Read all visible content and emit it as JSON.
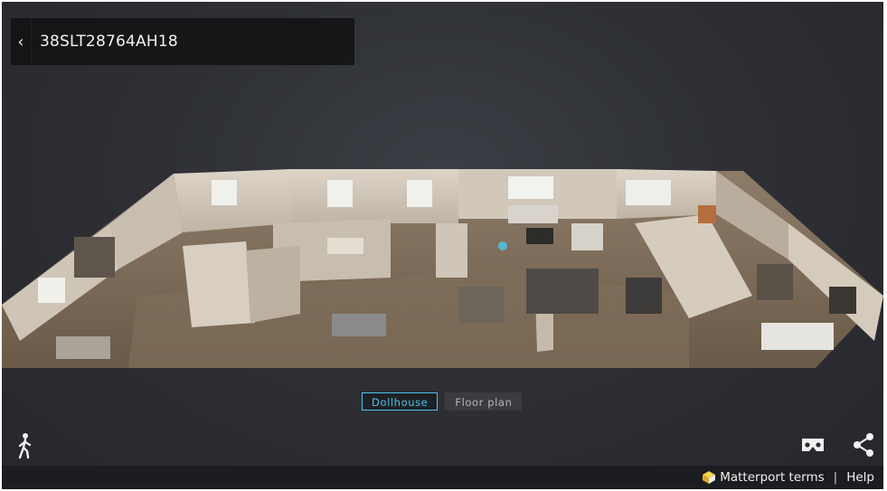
{
  "header": {
    "back_icon": "chevron-left-icon",
    "title": "38SLT28764AH18"
  },
  "mode_tabs": [
    {
      "label": "Dollhouse",
      "active": true
    },
    {
      "label": "Floor plan",
      "active": false
    }
  ],
  "controls": {
    "walk_icon": "walking-person-icon",
    "vr_icon": "vr-headset-icon",
    "share_icon": "share-icon"
  },
  "footer": {
    "terms_label": "Matterport terms",
    "separator": "|",
    "help_label": "Help"
  },
  "colors": {
    "accent": "#4fc3e8",
    "background": "#2e3035",
    "footer": "#1c1d20"
  }
}
